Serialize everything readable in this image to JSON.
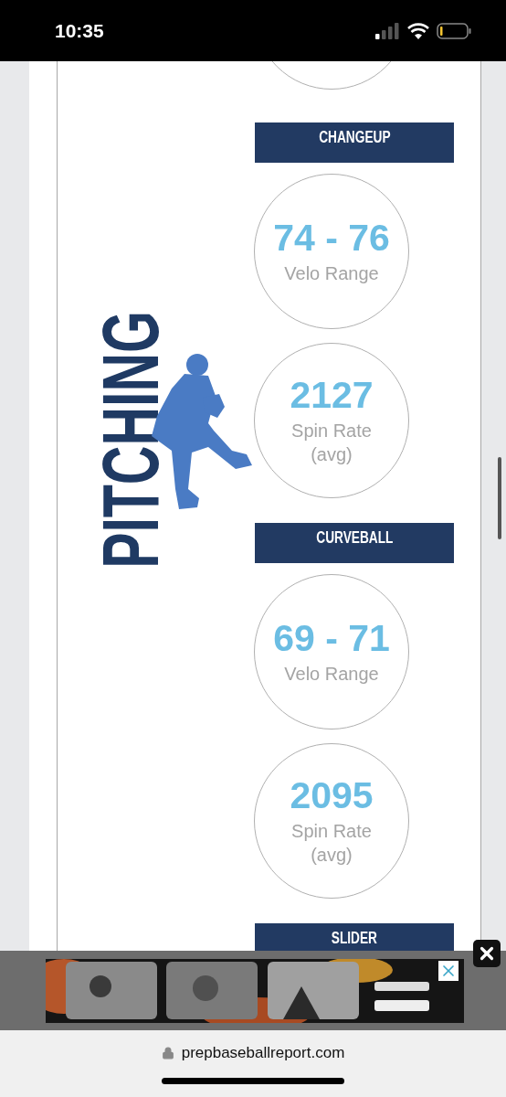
{
  "status_bar": {
    "time": "10:35"
  },
  "section": {
    "title": "PITCHING"
  },
  "pitches": [
    {
      "name": "CHANGEUP",
      "stats": [
        {
          "value": "74 - 76",
          "label": "Velo Range"
        },
        {
          "value": "2127",
          "label": "Spin Rate (avg)"
        }
      ]
    },
    {
      "name": "CURVEBALL",
      "stats": [
        {
          "value": "69 - 71",
          "label": "Velo Range"
        },
        {
          "value": "2095",
          "label": "Spin Rate (avg)"
        }
      ]
    },
    {
      "name": "SLIDER"
    }
  ],
  "browser": {
    "url": "prepbaseballreport.com"
  }
}
